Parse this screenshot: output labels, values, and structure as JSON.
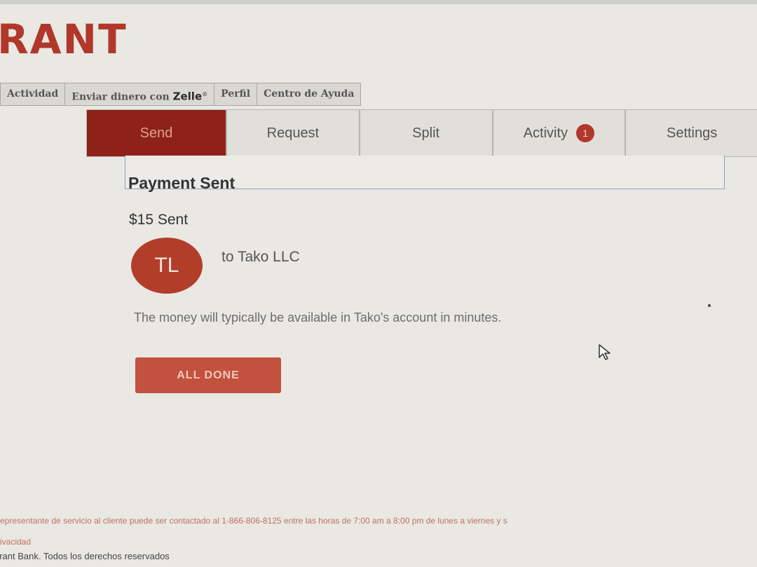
{
  "brand": {
    "logo_text": "RANT",
    "color": "#b1372a"
  },
  "top_nav": {
    "items": [
      "Actividad",
      "Enviar dinero con",
      "Perfil",
      "Centro de Ayuda"
    ],
    "zelle": "Zelle",
    "zelle_mark": "®"
  },
  "tabs": {
    "send": "Send",
    "request": "Request",
    "split": "Split",
    "activity": "Activity",
    "activity_badge": "1",
    "settings": "Settings"
  },
  "payment": {
    "title": "Payment Sent",
    "amount_text": "$15 Sent",
    "avatar_initials": "TL",
    "recipient_text": "to Tako LLC",
    "message": "The money will typically be available in Tako's account in minutes.",
    "done_button": "ALL DONE"
  },
  "footer": {
    "contact_text": "representante de servicio al cliente puede ser contactado al 1-866-806-8125 entre las horas de 7:00 am a 8:00 pm de lunes a viernes y s",
    "privacy_link": "rivacidad",
    "copyright": "erant Bank. Todos los derechos reservados"
  },
  "colors": {
    "accent": "#8e2218",
    "button": "#c2513d",
    "avatar": "#b23e2a"
  }
}
